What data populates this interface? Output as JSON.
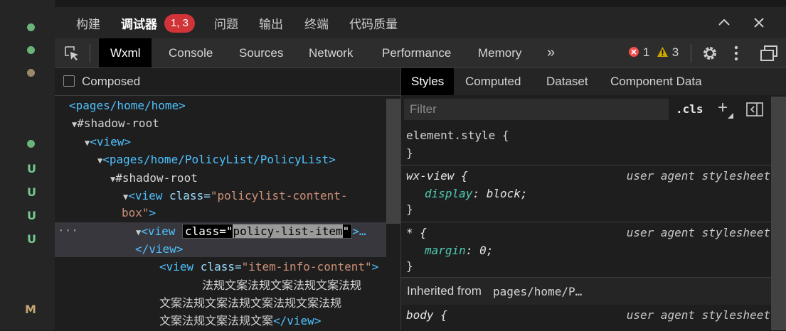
{
  "top_tabs": [
    {
      "label": "构建",
      "active": false
    },
    {
      "label": "调试器",
      "active": true
    },
    {
      "label": "问题",
      "active": false
    },
    {
      "label": "输出",
      "active": false
    },
    {
      "label": "终端",
      "active": false
    },
    {
      "label": "代码质量",
      "active": false
    }
  ],
  "debugger_badge": "1, 3",
  "devtools_tabs": [
    "Wxml",
    "Console",
    "Sources",
    "Network",
    "Performance",
    "Memory"
  ],
  "more_tabs_glyph": "»",
  "status": {
    "errors": "1",
    "warnings": "3"
  },
  "composed_label": "Composed",
  "tree": {
    "l1": "<pages/home/home>",
    "l2": "#shadow-root",
    "l3": "<view>",
    "l4": "<pages/home/PolicyList/PolicyList>",
    "l5": "#shadow-root",
    "l6_tag": "<view ",
    "l6_attr": "class=",
    "l6_val": "\"policylist-content-",
    "l6b_val": "box\"",
    "l6b_end": ">",
    "l7_tag": "<view ",
    "l7_edit_a": "class=\"",
    "l7_edit_sel": "policy-list-item",
    "l7_edit_b": "\"",
    "l7_end": ">…",
    "l7_close": "</view>",
    "l7_ellipsis": "···",
    "l8_tag": "<view ",
    "l8_attr": "class=",
    "l8_val": "\"item-info-content\"",
    "l8_end": ">",
    "l9": "法规文案法规文案法规文案法规",
    "l10": "文案法规文案法规文案法规文案法规",
    "l11_text": "文案法规文案法规文案",
    "l11_close": "</view>"
  },
  "styles_tabs": [
    "Styles",
    "Computed",
    "Dataset",
    "Component Data"
  ],
  "filter_placeholder": "Filter",
  "cls_label": ".cls",
  "plus_label": "+",
  "rules": {
    "r1_sel": "element.style {",
    "r1_close": "}",
    "r2_sel": "wx-view {",
    "r2_src": "user agent stylesheet",
    "r2_prop": "display",
    "r2_val": "block;",
    "r2_close": "}",
    "r3_sel": "* {",
    "r3_src": "user agent stylesheet",
    "r3_prop": "margin",
    "r3_val": "0;",
    "r3_close": "}",
    "inherited_label": "Inherited from",
    "inherited_from": "pages/home/P…",
    "r4_sel": "body {",
    "r4_src": "user agent stylesheet"
  },
  "gutter_marks": [
    "U",
    "U",
    "U",
    "U",
    "M"
  ],
  "colors": {
    "accent_badge": "#d13438",
    "error": "#f14c4c",
    "warning": "#cca700",
    "added": "#73c991"
  }
}
